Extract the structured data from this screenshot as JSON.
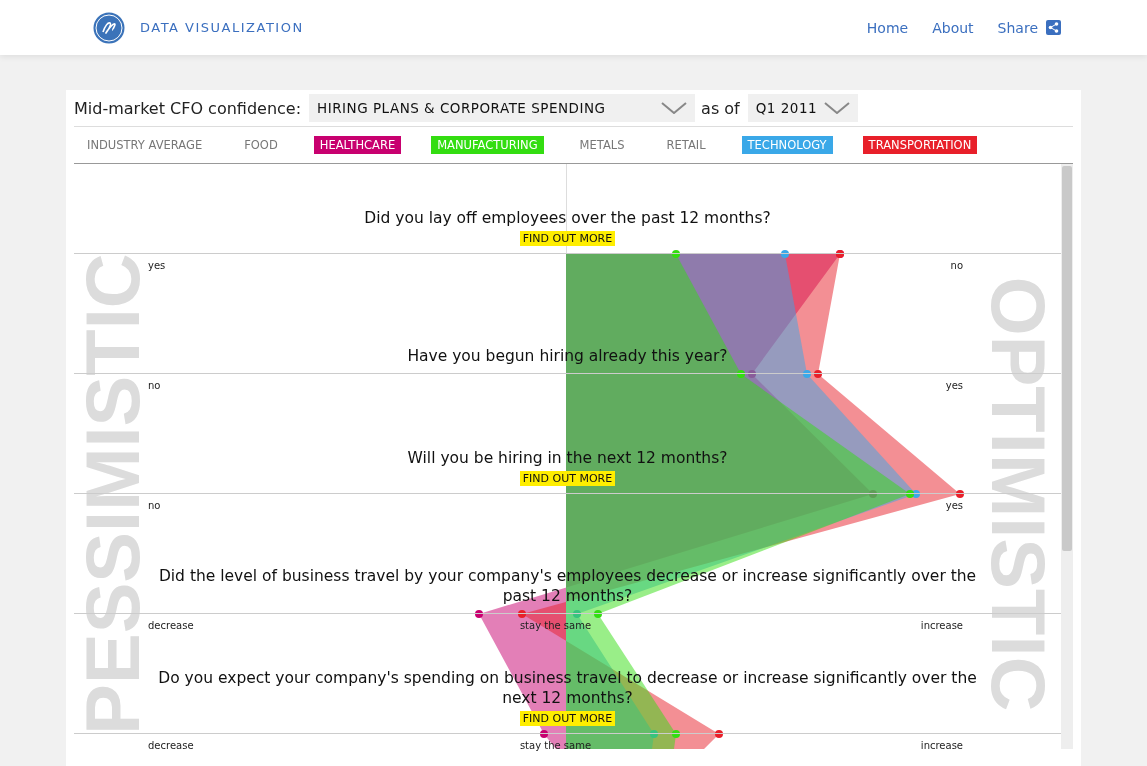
{
  "header": {
    "brand": "DATA VISUALIZATION",
    "nav": [
      "Home",
      "About",
      "Share"
    ]
  },
  "toolbar": {
    "label": "Mid-market CFO confidence:",
    "topic": "HIRING PLANS & CORPORATE SPENDING",
    "as_of_label": "as of",
    "period": "Q1 2011"
  },
  "industries": [
    {
      "label": "INDUSTRY AVERAGE",
      "selected": false
    },
    {
      "label": "FOOD",
      "selected": false
    },
    {
      "label": "HEALTHCARE",
      "selected": true,
      "color": "#c8006f"
    },
    {
      "label": "MANUFACTURING",
      "selected": true,
      "color": "#33dd11"
    },
    {
      "label": "METALS",
      "selected": false
    },
    {
      "label": "RETAIL",
      "selected": false
    },
    {
      "label": "TECHNOLOGY",
      "selected": true,
      "color": "#3aa8e8"
    },
    {
      "label": "TRANSPORTATION",
      "selected": true,
      "color": "#e8202a"
    }
  ],
  "side_labels": {
    "left": "PESSIMISTIC",
    "right": "OPTIMISTIC"
  },
  "questions": [
    {
      "text": "Did you lay off employees over the past 12 months?",
      "link": "FIND OUT MORE",
      "left": "yes",
      "right": "no"
    },
    {
      "text": "Have you begun hiring already this year?",
      "left": "no",
      "right": "yes"
    },
    {
      "text": "Will you be hiring in the next 12 months?",
      "link": "FIND OUT MORE",
      "left": "no",
      "right": "yes"
    },
    {
      "text": "Did the level of business travel by your company's employees decrease or increase significantly over the past 12 months?",
      "left": "decrease",
      "center": "stay the same",
      "right": "increase"
    },
    {
      "text": "Do you expect your company's spending on business travel to decrease or increase significantly over the next 12 months?",
      "link": "FIND OUT MORE",
      "left": "decrease",
      "center": "stay the same",
      "right": "increase"
    }
  ]
}
